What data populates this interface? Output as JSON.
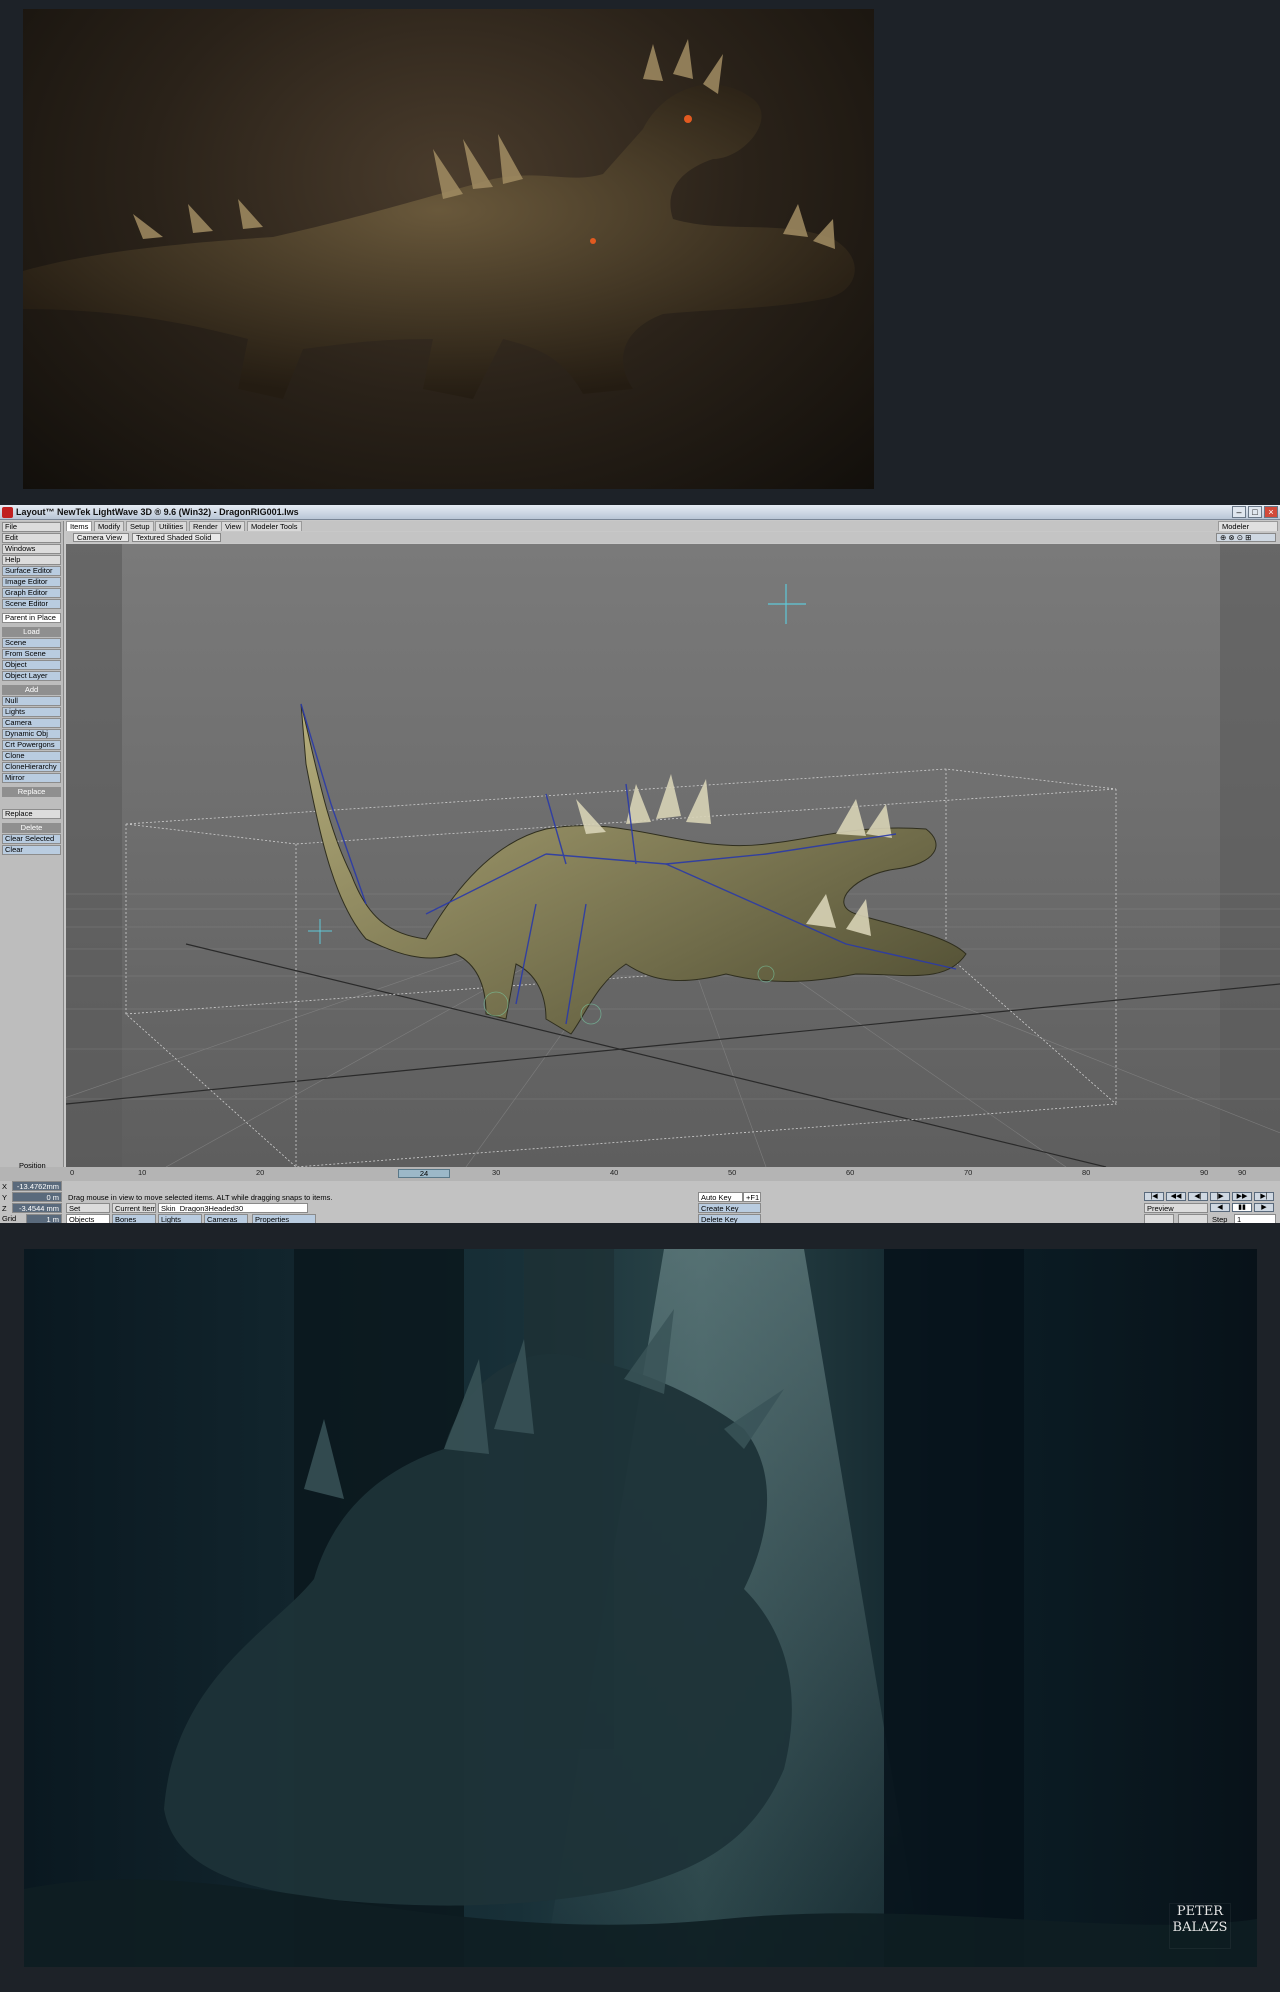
{
  "window": {
    "title": "Layout™ NewTek LightWave 3D ® 9.6  (Win32) - DragonRIG001.lws",
    "modeler_button": "Modeler"
  },
  "left_panel": {
    "top_menu": [
      "File",
      "Edit",
      "Windows",
      "Help"
    ],
    "editors": [
      "Surface Editor",
      "Image Editor",
      "Graph Editor",
      "Scene Editor"
    ],
    "parent_in_place": "Parent in Place",
    "load_header": "Load",
    "load_items": [
      "Scene",
      "From Scene",
      "Object",
      "Object Layer"
    ],
    "add_header": "Add",
    "add_items": [
      "Null",
      "Lights",
      "Camera",
      "Dynamic Obj",
      "Crt Powergons",
      "Clone",
      "CloneHierarchy",
      "Mirror"
    ],
    "replace_header": "Replace",
    "replace_items": [
      "Replace"
    ],
    "delete_header": "Delete",
    "delete_items": [
      "Clear Selected",
      "Clear"
    ]
  },
  "tabs": [
    "Items",
    "Modify",
    "Setup",
    "Utilities",
    "Render",
    "View",
    "Modeler Tools"
  ],
  "viewport": {
    "view_mode": "Camera View",
    "render_mode": "Textured Shaded Solid"
  },
  "timeline": {
    "ticks": [
      "0",
      "10",
      "20",
      "30",
      "40",
      "50",
      "60",
      "70",
      "80",
      "90"
    ],
    "current_frame": "24",
    "end_frame": "90"
  },
  "status": {
    "position_label": "Position",
    "x_value": "-13.4762mm",
    "y_value": "0 m",
    "z_value": "-3.4544 mm",
    "grid_label": "Grid",
    "grid_value": "1 m",
    "hint": "Drag mouse in view to move selected items. ALT while dragging snaps to items.",
    "set_button": "Set",
    "current_item_label": "Current Item",
    "current_item": "Skin_Dragon3Headed30",
    "objects_label": "Objects",
    "bones_label": "Bones",
    "lights_label": "Lights",
    "cameras_label": "Cameras",
    "properties_label": "Properties",
    "auto_key": "Auto Key",
    "auto_key_shortcut": "+F1",
    "create_key": "Create Key",
    "delete_key": "Delete Key",
    "preview": "Preview",
    "step_label": "Step",
    "step_value": "1"
  },
  "signature": "PETER BALAZS"
}
